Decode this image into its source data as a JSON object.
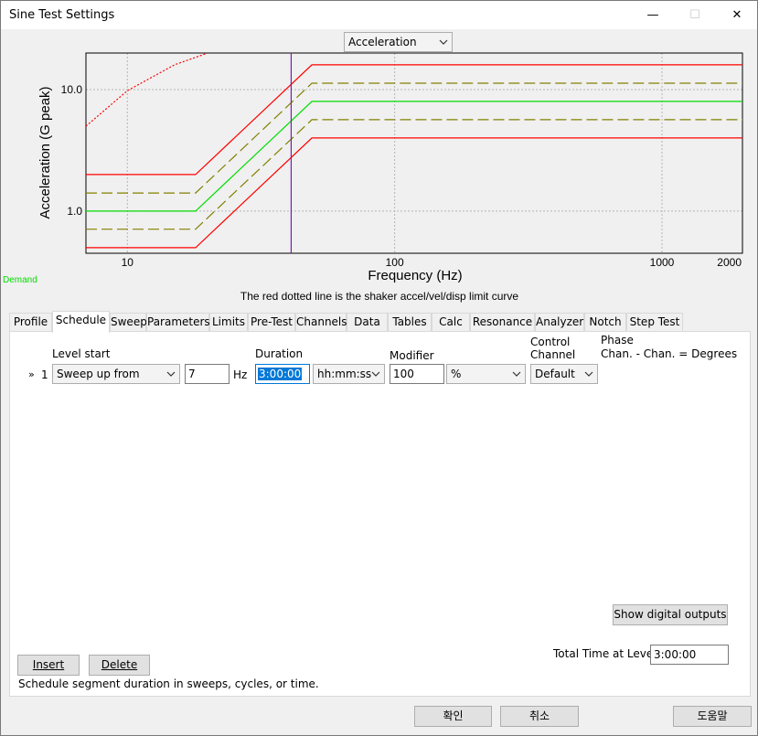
{
  "window": {
    "title": "Sine Test Settings",
    "minimize_glyph": "—",
    "maximize_glyph": "☐",
    "close_glyph": "✕"
  },
  "chart_selector": {
    "value": "Acceleration"
  },
  "chart_data": {
    "type": "line",
    "xlabel": "Frequency (Hz)",
    "ylabel": "Acceleration (G peak)",
    "x_scale": "log",
    "y_scale": "log",
    "xlim": [
      7,
      2000
    ],
    "ylim": [
      0.45,
      20
    ],
    "x_ticks": [
      {
        "v": 10,
        "label": "10"
      },
      {
        "v": 100,
        "label": "100"
      },
      {
        "v": 1000,
        "label": "1000"
      },
      {
        "v": 2000,
        "label": "2000"
      }
    ],
    "y_ticks": [
      {
        "v": 1,
        "label": "1.0"
      },
      {
        "v": 10,
        "label": "10.0"
      }
    ],
    "grid": true,
    "marker_x": 41,
    "series": [
      {
        "color": "#ff0000",
        "style": "solid",
        "points": [
          [
            7,
            2.0
          ],
          [
            18,
            2.0
          ],
          [
            49,
            16
          ],
          [
            2000,
            16
          ]
        ]
      },
      {
        "color": "#808000",
        "style": "dashed",
        "points": [
          [
            7,
            1.41
          ],
          [
            18,
            1.41
          ],
          [
            49,
            11.3
          ],
          [
            2000,
            11.3
          ]
        ]
      },
      {
        "color": "#00dd00",
        "style": "solid",
        "points": [
          [
            7,
            1.0
          ],
          [
            18,
            1.0
          ],
          [
            49,
            8.0
          ],
          [
            2000,
            8.0
          ]
        ]
      },
      {
        "color": "#808000",
        "style": "dashed",
        "points": [
          [
            7,
            0.71
          ],
          [
            18,
            0.71
          ],
          [
            49,
            5.66
          ],
          [
            2000,
            5.66
          ]
        ]
      },
      {
        "color": "#ff0000",
        "style": "solid",
        "points": [
          [
            7,
            0.5
          ],
          [
            18,
            0.5
          ],
          [
            49,
            4.0
          ],
          [
            2000,
            4.0
          ]
        ]
      },
      {
        "color": "#ff0000",
        "style": "dotted",
        "points": [
          [
            7,
            5.0
          ],
          [
            10,
            9.8
          ],
          [
            15,
            16
          ],
          [
            20,
            20
          ]
        ]
      }
    ],
    "caption": "The red dotted line is the shaker accel/vel/disp limit curve",
    "legend_label": "Demand"
  },
  "tabs": [
    "Profile",
    "Schedule",
    "Sweep",
    "Parameters",
    "Limits",
    "Pre-Test",
    "Channels",
    "Data",
    "Tables",
    "Calc",
    "Resonance",
    "Analyzer",
    "Notch",
    "Step Test"
  ],
  "schedule": {
    "headers": {
      "level_start": "Level start",
      "duration": "Duration",
      "modifier": "Modifier",
      "control_channel": "Control\nChannel",
      "phase": "Phase",
      "phase_sub": "Chan. - Chan. = Degrees"
    },
    "row": {
      "marker": "»",
      "index": "1",
      "level_start": "Sweep up from",
      "freq": "7",
      "freq_unit": "Hz",
      "duration": "3:00:00",
      "duration_unit": "hh:mm:ss",
      "modifier": "100",
      "modifier_unit": "%",
      "control_channel": "Default"
    },
    "show_digital_outputs": "Show digital outputs",
    "insert": "Insert",
    "delete": "Delete",
    "total_time_label": "Total Time at Level",
    "total_time_value": "3:00:00",
    "hint": "Schedule segment duration in sweeps, cycles, or time."
  },
  "footer": {
    "ok": "확인",
    "cancel": "취소",
    "help": "도움말"
  }
}
